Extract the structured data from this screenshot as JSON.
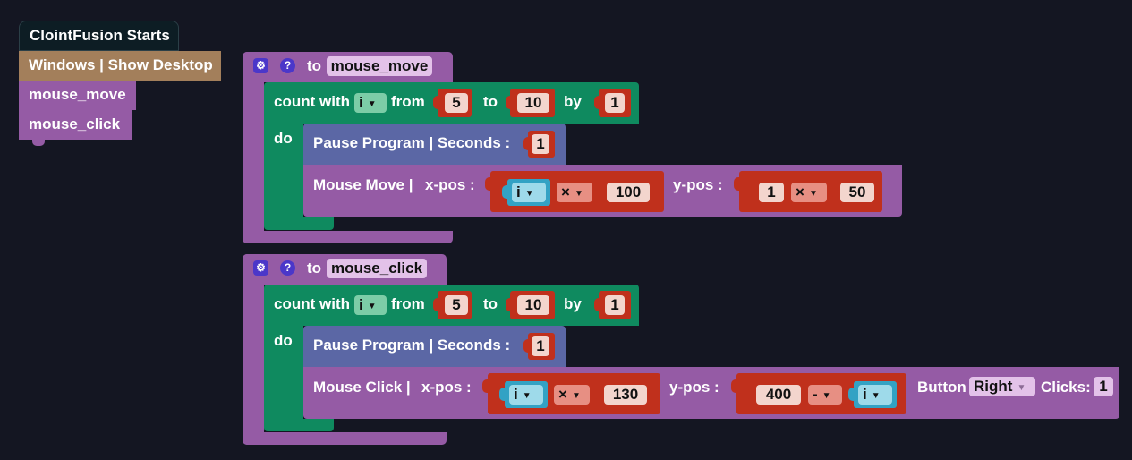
{
  "colors": {
    "background": "#141622",
    "event_block": "#0d1d24",
    "windows_block": "#a37f5b",
    "procedure_block": "#955ba5",
    "loop_block": "#0f8a5f",
    "pause_block": "#5b67a5",
    "math_block": "#c0301c",
    "var_block": "#33a2c4",
    "number_field": "#f3d5cd",
    "name_field": "#e3c2e9"
  },
  "stack": {
    "event_label": "ClointFusion Starts",
    "windows_label": "Windows | Show Desktop",
    "call1_label": "mouse_move",
    "call2_label": "mouse_click"
  },
  "func1": {
    "gear_icon": "⚙",
    "help_icon": "?",
    "to_label": "to",
    "name": "mouse_move",
    "loop": {
      "count_label": "count with",
      "var": "i",
      "from_label": "from",
      "from": "5",
      "to_label": "to",
      "to": "10",
      "by_label": "by",
      "by": "1",
      "do_label": "do"
    },
    "pause": {
      "label": "Pause Program | Seconds :",
      "value": "1"
    },
    "action": {
      "label": "Mouse Move |",
      "x_label": "x-pos :",
      "x_var": "i",
      "x_op": "×",
      "x_num": "100",
      "y_label": "y-pos :",
      "y_num1": "1",
      "y_op": "×",
      "y_num2": "50"
    }
  },
  "func2": {
    "gear_icon": "⚙",
    "help_icon": "?",
    "to_label": "to",
    "name": "mouse_click",
    "loop": {
      "count_label": "count with",
      "var": "i",
      "from_label": "from",
      "from": "5",
      "to_label": "to",
      "to": "10",
      "by_label": "by",
      "by": "1",
      "do_label": "do"
    },
    "pause": {
      "label": "Pause Program | Seconds :",
      "value": "1"
    },
    "action": {
      "label": "Mouse Click |",
      "x_label": "x-pos :",
      "x_var": "i",
      "x_op": "×",
      "x_num": "130",
      "y_label": "y-pos :",
      "y_num": "400",
      "y_op": "-",
      "y_var": "i",
      "button_label": "Button",
      "button_value": "Right",
      "clicks_label": "Clicks:",
      "clicks_value": "1"
    }
  }
}
